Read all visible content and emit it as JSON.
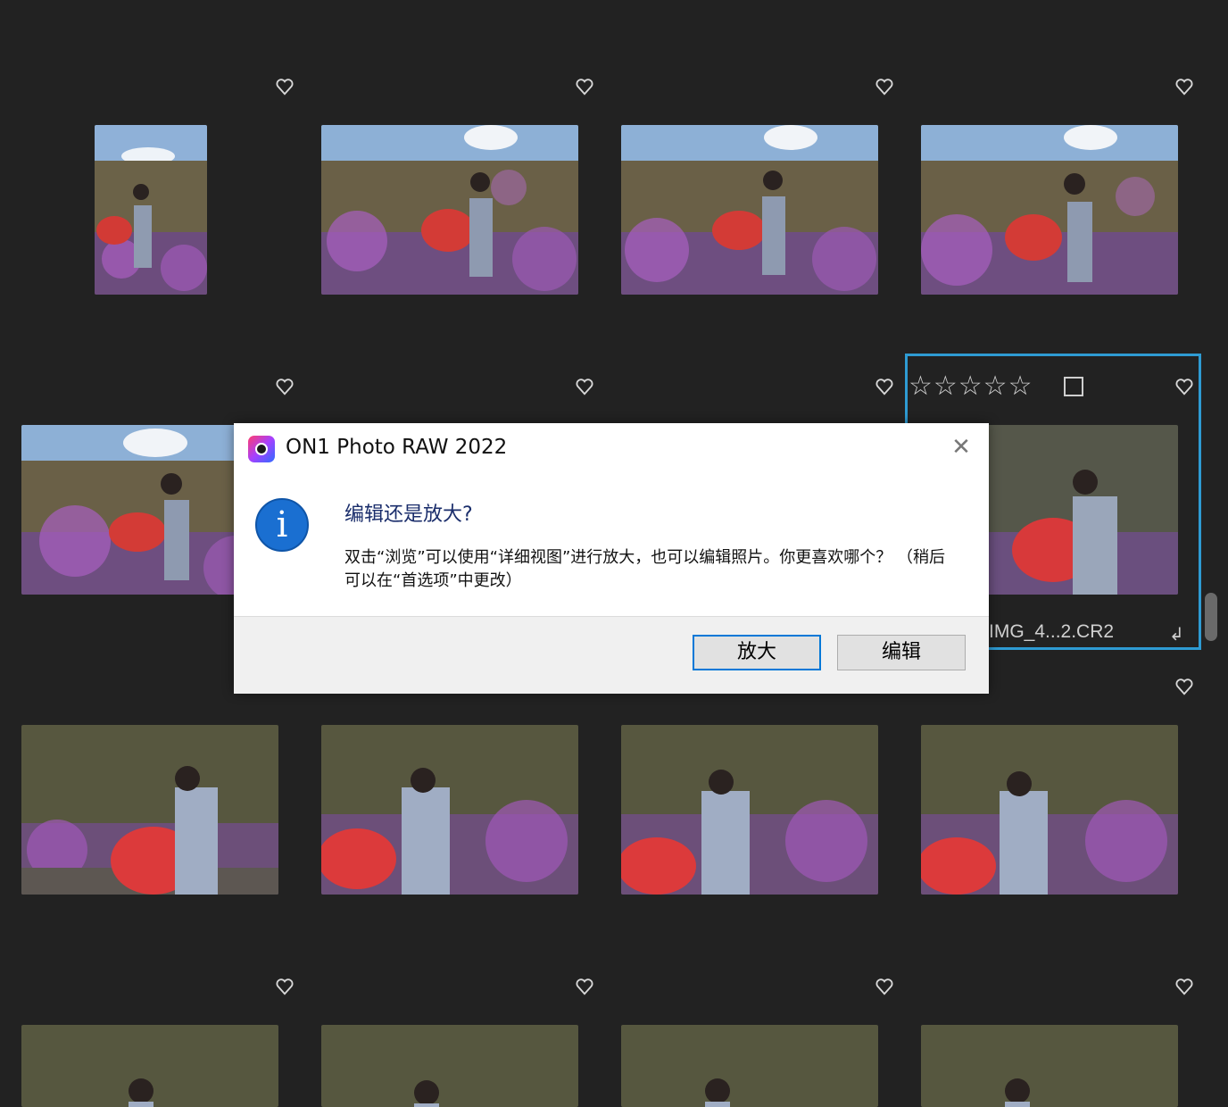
{
  "app": {
    "name": "ON1 Photo RAW 2022"
  },
  "dialog": {
    "title": "ON1 Photo RAW 2022",
    "close_icon": "close-icon",
    "heading": "编辑还是放大?",
    "message": "双击“浏览”可以使用“详细视图”进行放大，也可以编辑照片。你更喜欢哪个？ （稍后可以在“首选项”中更改）",
    "buttons": {
      "zoom_label": "放大",
      "edit_label": "编辑"
    }
  },
  "grid": {
    "selected": {
      "rating_stars": "☆☆☆☆☆",
      "filename": "IMG_4...2.CR2",
      "return_icon": "↲"
    },
    "heart_icon": "heart-outline-icon"
  },
  "colors": {
    "background": "#222222",
    "selection": "#2e9bd3",
    "dialog_primary_border": "#0078d7",
    "info_icon": "#1a6fd1"
  }
}
